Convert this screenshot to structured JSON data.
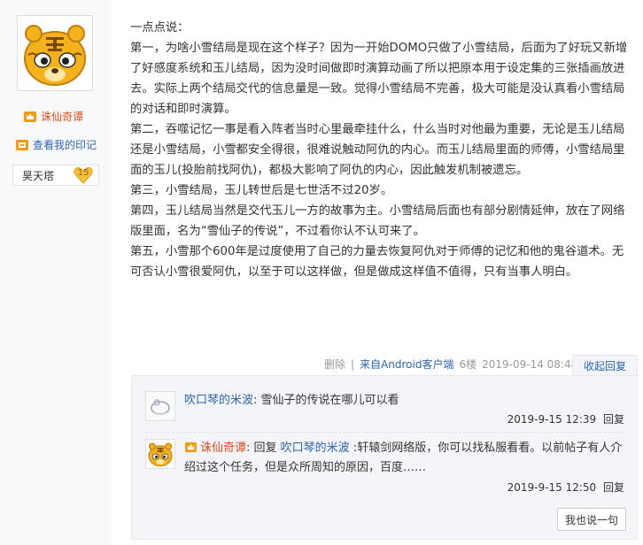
{
  "author": {
    "name": "诛仙奇谭",
    "imprint_link": "查看我的印记",
    "badge_title": "昊天塔",
    "badge_level": "15"
  },
  "post": {
    "paragraphs": [
      "一点点说：",
      "第一，为啥小雪结局是现在这个样子？因为一开始DOMO只做了小雪结局，后面为了好玩又新增了好感度系统和玉儿结局，因为没时间做即时演算动画了所以把原本用于设定集的三张插画放进去。实际上两个结局交代的信息量是一致。觉得小雪结局不完善，极大可能是没认真看小雪结局的对话和即时演算。",
      "第二，吞噬记忆一事是看入阵者当时心里最牵挂什么，什么当时对他最为重要，无论是玉儿结局还是小雪结局，小雪都安全得很，很难说触动阿仇的内心。而玉儿结局里面的师傅，小雪结局里面的玉儿(投胎前找阿仇)，都极大影响了阿仇的内心，因此触发机制被遗忘。",
      "第三，小雪结局，玉儿转世后是七世活不过20岁。",
      "第四，玉儿结局当然是交代玉儿一方的故事为主。小雪结局后面也有部分剧情延伸，放在了网络版里面，名为“雪仙子的传说”，不过看你认不认可来了。",
      "第五，小雪那个600年是过度使用了自己的力量去恢复阿仇对于师傅的记忆和他的鬼谷道术。无可否认小雪很爱阿仇，以至于可以这样做，但是做成这样值不值得，只有当事人明白。"
    ],
    "delete_label": "删除",
    "source": "来自Android客户端",
    "floor": "6楼",
    "time": "2019-09-14 08:48",
    "collapse_label": "收起回复"
  },
  "replies": [
    {
      "user": "吹口琴的米波",
      "sep": ": ",
      "text": "雪仙子的传说在哪儿可以看",
      "time": "2019-9-15 12:39",
      "reply_label": "回复"
    },
    {
      "user": "诛仙奇谭",
      "sep": ": ",
      "reply_word": "回复 ",
      "target": "吹口琴的米波",
      "text": " :轩辕剑网络版，你可以找私服看看。以前帖子有人介绍过这个任务，但是众所周知的原因，百度……",
      "time": "2019-9-15 12:50",
      "reply_label": "回复"
    }
  ],
  "say_button": "我也说一句",
  "colors": {
    "link": "#2d64b3",
    "author": "#e64a19",
    "reply_bg": "#f3f5f8"
  },
  "icons": [
    "tiger-avatar-icon",
    "crown-icon",
    "imprint-icon",
    "heart-level-icon",
    "default-avatar-icon"
  ]
}
